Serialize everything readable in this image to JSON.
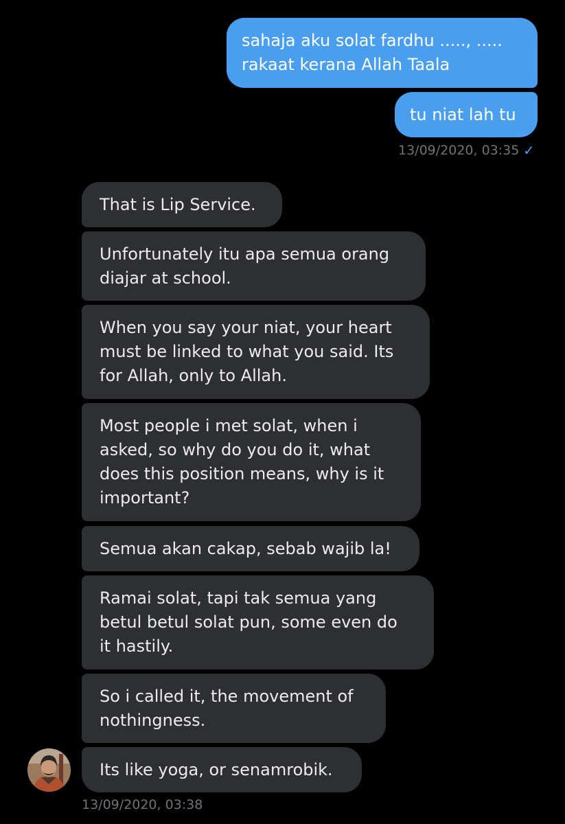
{
  "conversation": {
    "sent": [
      {
        "text": "sahaja aku solat fardhu ....., .....\nrakaat kerana Allah Taala"
      },
      {
        "text": "tu niat lah tu"
      }
    ],
    "sent_timestamp": "13/09/2020, 03:35",
    "received": [
      {
        "text": "That is Lip Service."
      },
      {
        "text": "Unfortunately itu apa semua orang\ndiajar at school."
      },
      {
        "text": "When you say your niat, your heart\nmust be linked to what you said. Its\nfor Allah, only to Allah."
      },
      {
        "text": "Most people i met solat, when i\nasked, so why do you do it, what\ndoes this position means, why is it\nimportant?"
      },
      {
        "text": "Semua akan cakap, sebab wajib la!"
      },
      {
        "text": "Ramai solat, tapi tak semua yang\nbetul betul solat pun, some even do\nit hastily."
      },
      {
        "text": "So i called it, the movement of\nnothingness."
      },
      {
        "text": "Its like yoga, or senamrobik."
      }
    ],
    "received_timestamp": "13/09/2020, 03:38"
  },
  "icons": {
    "read_receipt": "checkmark-icon",
    "avatar": "user-avatar"
  },
  "colors": {
    "sent_bubble": "#4a9ef0",
    "received_bubble": "#2e2f33",
    "background": "#000000",
    "timestamp": "#6f7378"
  }
}
